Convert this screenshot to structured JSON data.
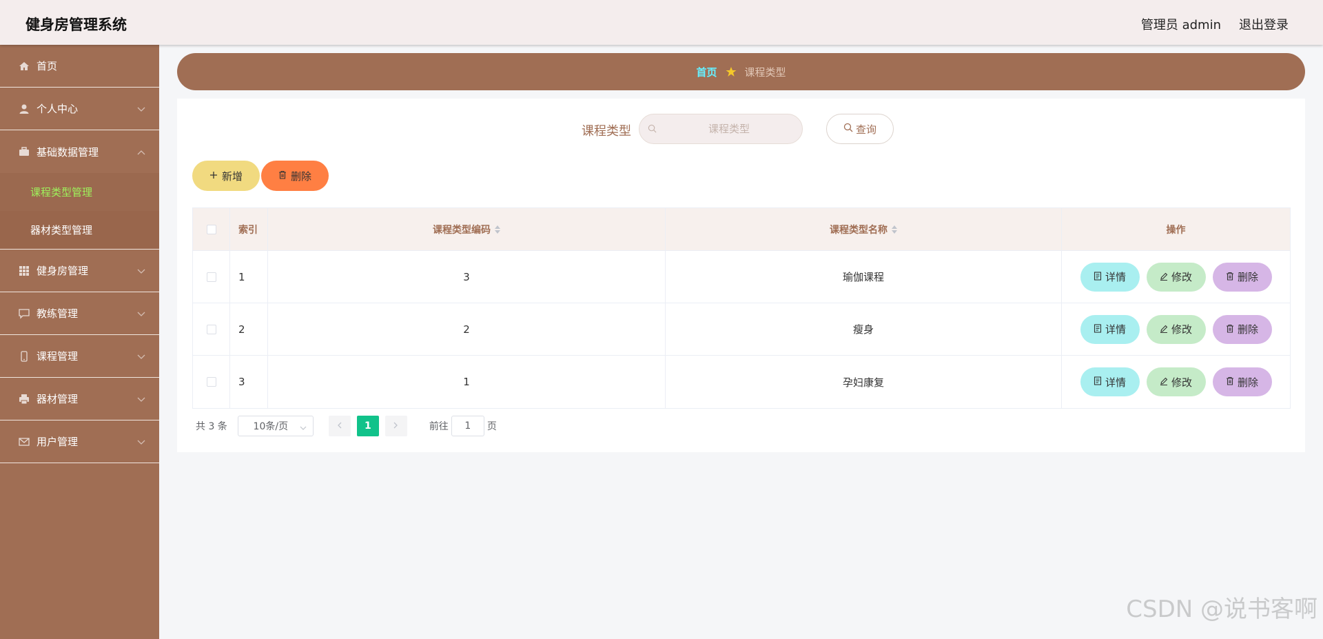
{
  "header": {
    "title": "健身房管理系统",
    "user": "管理员 admin",
    "logout": "退出登录"
  },
  "sidebar": {
    "items": [
      {
        "label": "首页",
        "icon": "home-icon"
      },
      {
        "label": "个人中心",
        "icon": "user-icon"
      },
      {
        "label": "基础数据管理",
        "icon": "briefcase-icon",
        "sub": [
          "课程类型管理",
          "器材类型管理"
        ],
        "active_sub": "课程类型管理"
      },
      {
        "label": "健身房管理",
        "icon": "grid-icon"
      },
      {
        "label": "教练管理",
        "icon": "chat-icon"
      },
      {
        "label": "课程管理",
        "icon": "phone-icon"
      },
      {
        "label": "器材管理",
        "icon": "printer-icon"
      },
      {
        "label": "用户管理",
        "icon": "mail-icon"
      }
    ]
  },
  "breadcrumb": {
    "home": "首页",
    "current": "课程类型"
  },
  "search": {
    "label": "课程类型",
    "placeholder": "课程类型",
    "button": "查询"
  },
  "actions": {
    "add": "新增",
    "delete": "删除"
  },
  "table": {
    "columns": {
      "index": "索引",
      "code": "课程类型编码",
      "name": "课程类型名称",
      "ops": "操作"
    },
    "rows": [
      {
        "index": "1",
        "code": "3",
        "name": "瑜伽课程"
      },
      {
        "index": "2",
        "code": "2",
        "name": "瘦身"
      },
      {
        "index": "3",
        "code": "1",
        "name": "孕妇康复"
      }
    ],
    "row_buttons": {
      "detail": "详情",
      "edit": "修改",
      "delete": "删除"
    }
  },
  "pagination": {
    "total": "共 3 条",
    "page_size": "10条/页",
    "current_page": "1",
    "goto_prefix": "前往",
    "goto_value": "1",
    "goto_suffix": "页"
  },
  "watermark": "CSDN @说书客啊",
  "colors": {
    "brand": "#a06e54",
    "header_bg": "#f4eded",
    "active_sub": "#9ef25c",
    "page_active": "#11c28a"
  }
}
